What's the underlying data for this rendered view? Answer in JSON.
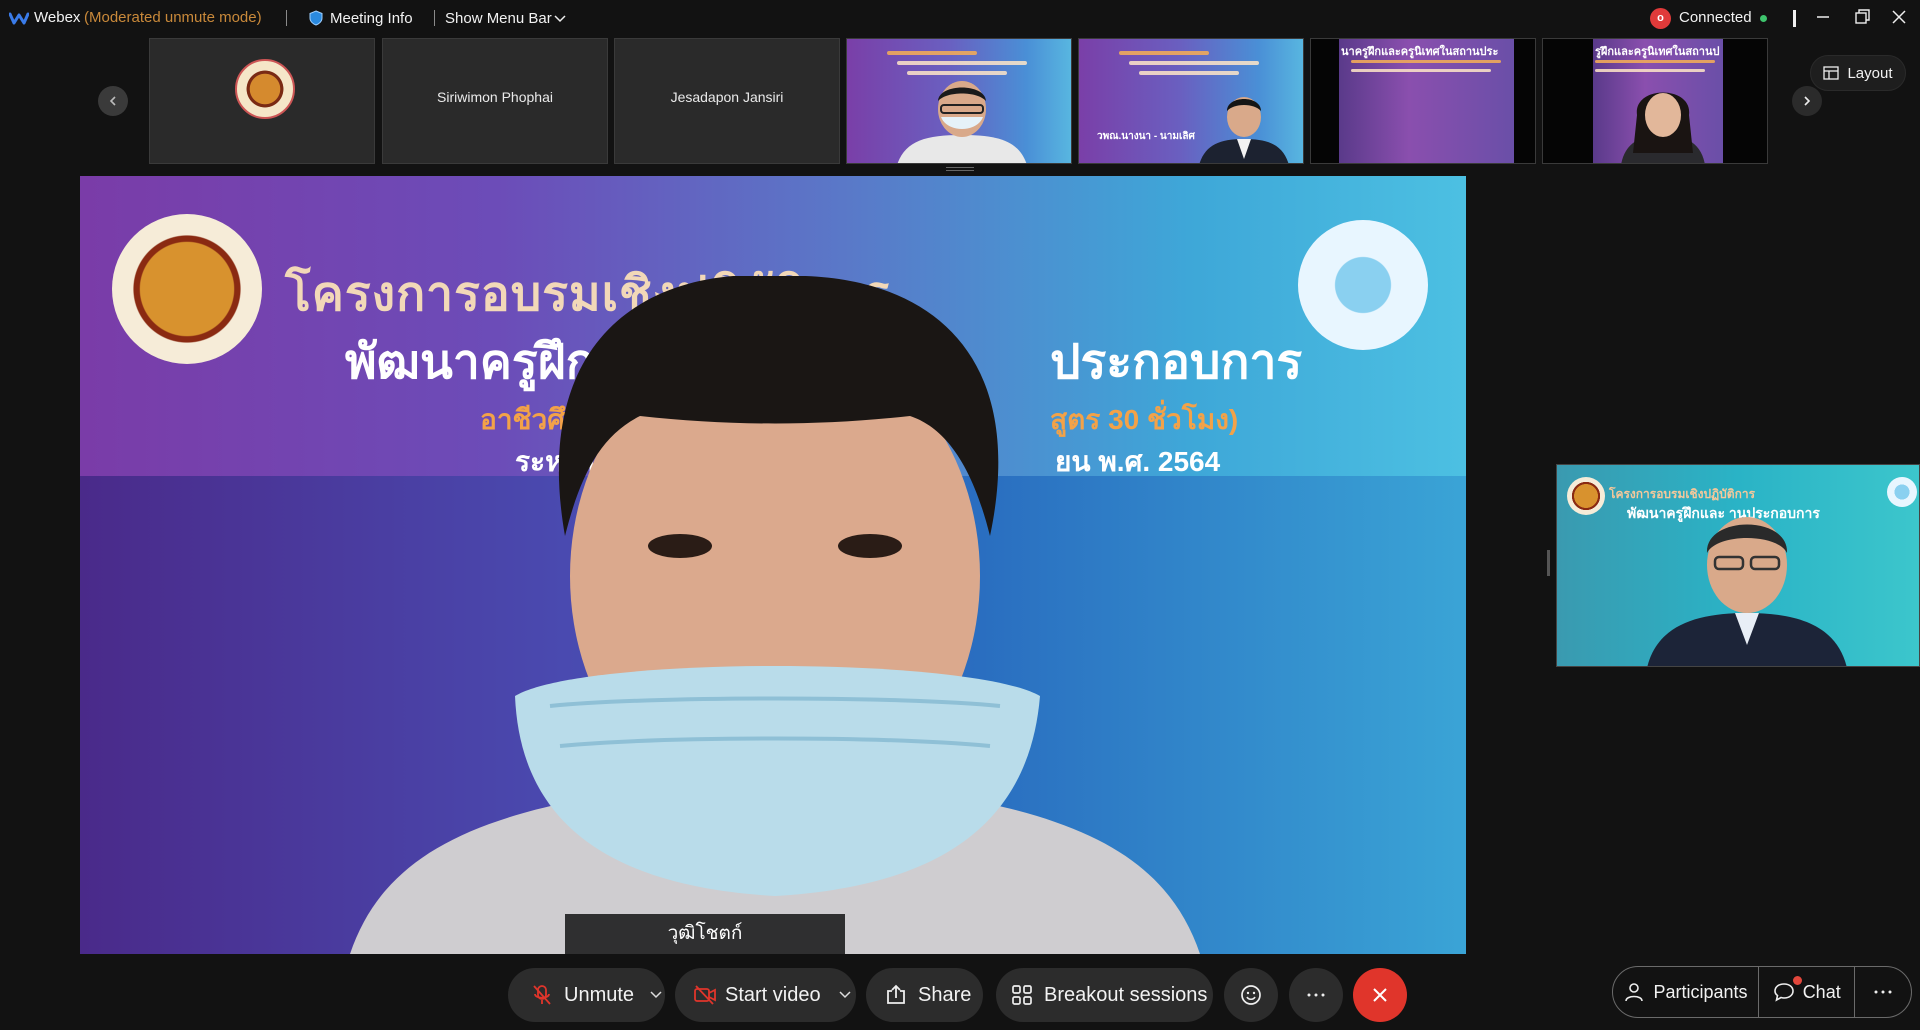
{
  "window": {
    "app_name": "Webex",
    "mode_label": "(Moderated unmute mode)",
    "meeting_info_label": "Meeting Info",
    "show_menu_bar_label": "Show Menu Bar",
    "recording_badge": "o",
    "connection_status": "Connected",
    "status_color": "#3ec46d",
    "mode_color": "#c9893a"
  },
  "thumbnails": [
    {
      "type": "avatar-logo",
      "name": ""
    },
    {
      "type": "name",
      "name": "Siriwimon Phophai"
    },
    {
      "type": "name",
      "name": "Jesadapon Jansiri"
    },
    {
      "type": "video",
      "name": ""
    },
    {
      "type": "video",
      "name": "",
      "caption": "วพณ.นางนา - นามเลิศ"
    },
    {
      "type": "video",
      "name": ""
    },
    {
      "type": "video",
      "name": ""
    }
  ],
  "thumb_slide_texts": {
    "t6_line1": "นาครูฝึกและครูนิเทศในสถานประ",
    "t7_line1": "รูฝึกและครูนิเทศในสถานป"
  },
  "layout_button": {
    "label": "Layout"
  },
  "main_video": {
    "slide_line1": "โครงการอบรมเชิงปฏิบัติการ",
    "slide_line2_left": "พัฒนาครูฝึกและ",
    "slide_line2_right": "ประกอบการ",
    "slide_line3_left": "อาชีวศึกษา",
    "slide_line3_right": "สูตร 30 ชั่วโมง)",
    "slide_line4_left": "ระหว่าง",
    "slide_line4_right": "ยน พ.ศ. 2564",
    "speaker_name": "วุฒิโชตก์"
  },
  "side_video": {
    "slide_line1": "โครงการอบรมเชิงปฏิบัติการ",
    "slide_line2": "พัฒนาครูฝึกและ          านประกอบการ"
  },
  "controls": {
    "unmute_label": "Unmute",
    "start_video_label": "Start video",
    "share_label": "Share",
    "breakout_label": "Breakout sessions",
    "participants_label": "Participants",
    "chat_label": "Chat",
    "accent_leave": "#e0352b",
    "muted_icon_color": "#e0352b"
  }
}
